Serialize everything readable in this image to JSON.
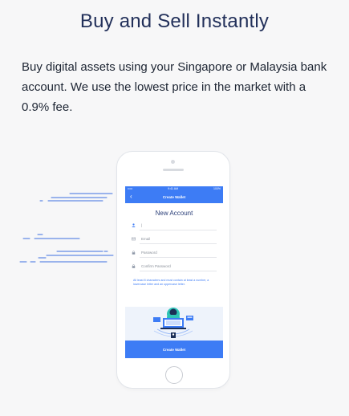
{
  "section": {
    "title": "Buy and Sell Instantly",
    "description": "Buy digital assets using your Singapore or Malaysia bank account. We use the lowest price in the market with a 0.9% fee."
  },
  "phone_screen": {
    "status_bar": {
      "carrier": "•••••",
      "time": "9:41 AM",
      "battery": "100%"
    },
    "nav": {
      "back_icon": "chevron-left-icon",
      "title": "Create Wallet"
    },
    "form": {
      "title": "New Account",
      "fields": [
        {
          "icon": "user-icon",
          "value": "|"
        },
        {
          "icon": "email-icon",
          "placeholder": "Email"
        },
        {
          "icon": "lock-icon",
          "placeholder": "Password"
        },
        {
          "icon": "lock-icon",
          "placeholder": "Confirm Password"
        }
      ],
      "hint": "All least 8 characters and must contain at least a number, a lowercase letter and an uppercase letter.",
      "submit_label": "Create Wallet"
    }
  },
  "colors": {
    "accent": "#3d7cf5",
    "title": "#22305a",
    "background": "#f7f7f8"
  }
}
